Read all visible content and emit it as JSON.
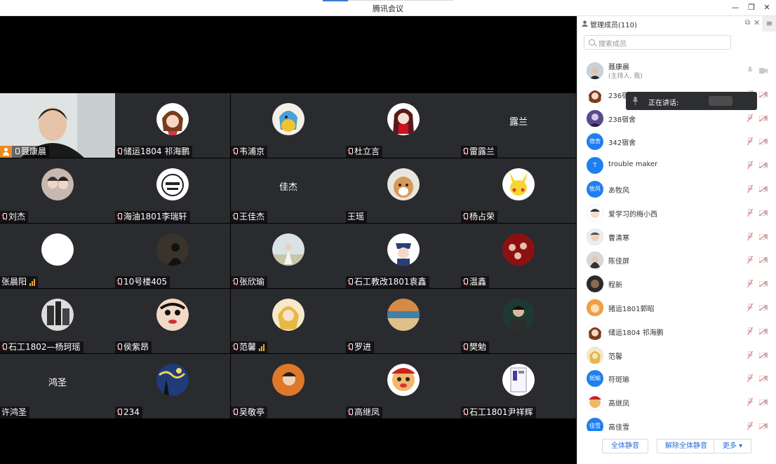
{
  "window": {
    "title": "腾讯会议"
  },
  "tiles": [
    {
      "name": "聂康晨",
      "host": true,
      "mic": "on",
      "type": "video"
    },
    {
      "name": "储运1804 祁海鹏",
      "mic": "muted",
      "type": "avatar",
      "av": "av-anime1"
    },
    {
      "name": "韦浦京",
      "mic": "muted",
      "type": "avatar",
      "av": "av-duck"
    },
    {
      "name": "杜立言",
      "mic": "muted",
      "type": "avatar",
      "av": "av-anime2"
    },
    {
      "name": "雷露兰",
      "mic": "muted",
      "type": "text",
      "big": "露兰"
    },
    {
      "name": "刘杰",
      "mic": "muted",
      "type": "avatar",
      "av": "av-couple"
    },
    {
      "name": "海油1801李瑞轩",
      "mic": "muted",
      "type": "avatar",
      "av": "av-meme"
    },
    {
      "name": "王佳杰",
      "mic": "muted",
      "type": "text",
      "big": "佳杰"
    },
    {
      "name": "王瑶",
      "mic": "none",
      "type": "avatar",
      "av": "av-dog"
    },
    {
      "name": "杨占荣",
      "mic": "muted",
      "type": "avatar",
      "av": "av-pikachu"
    },
    {
      "name": "张晨阳",
      "mic": "none",
      "signal": true,
      "type": "avatar",
      "av": "av-white"
    },
    {
      "name": "10号楼405",
      "mic": "muted",
      "type": "avatar",
      "av": "av-dark"
    },
    {
      "name": "张欣瑜",
      "mic": "muted",
      "type": "avatar",
      "av": "av-girl"
    },
    {
      "name": "石工教改1801袁鑫",
      "mic": "muted",
      "type": "avatar",
      "av": "av-police"
    },
    {
      "name": "温鑫",
      "mic": "muted",
      "type": "avatar",
      "av": "av-red"
    },
    {
      "name": "石工1802—杨珂瑶",
      "mic": "muted",
      "type": "avatar",
      "av": "av-city"
    },
    {
      "name": "侯紫昂",
      "mic": "muted",
      "type": "avatar",
      "av": "av-shin"
    },
    {
      "name": "范馨",
      "mic": "muted",
      "signal": true,
      "type": "avatar",
      "av": "av-yellow"
    },
    {
      "name": "罗进",
      "mic": "muted",
      "type": "avatar",
      "av": "av-sea"
    },
    {
      "name": "樊勉",
      "mic": "muted",
      "type": "avatar",
      "av": "av-boy"
    },
    {
      "name": "许鸿圣",
      "mic": "none",
      "type": "text",
      "big": "鸿圣"
    },
    {
      "name": "234",
      "mic": "muted",
      "type": "avatar",
      "av": "av-starry"
    },
    {
      "name": "吴敬亭",
      "mic": "muted",
      "type": "avatar",
      "av": "av-orange"
    },
    {
      "name": "高继凤",
      "mic": "muted",
      "type": "avatar",
      "av": "av-cartoon"
    },
    {
      "name": "石工1801尹祥辉",
      "mic": "muted",
      "type": "avatar",
      "av": "av-doc"
    }
  ],
  "panel": {
    "title": "管理成员(110)",
    "search_placeholder": "搜索成员",
    "tooltip": "正在讲话:",
    "members": [
      {
        "name": "聂康晨",
        "sub": "(主持人, 我)",
        "av": "photo",
        "mic": "on"
      },
      {
        "name": "236宿",
        "av": "anime",
        "mic": "off"
      },
      {
        "name": "238宿舍",
        "av": "purple",
        "mic": "off"
      },
      {
        "name": "342宿舍",
        "av": "text",
        "avtext": "宿舍",
        "mic": "off"
      },
      {
        "name": "trouble maker",
        "av": "text",
        "avtext": "T",
        "mic": "off"
      },
      {
        "name": "あ牧风",
        "av": "text",
        "avtext": "牧风",
        "mic": "off"
      },
      {
        "name": "爱学习的梅小西",
        "av": "cartoon",
        "mic": "off"
      },
      {
        "name": "曹清寒",
        "av": "boy",
        "mic": "off"
      },
      {
        "name": "陈佳屏",
        "av": "girl",
        "mic": "off"
      },
      {
        "name": "程新",
        "av": "dark",
        "mic": "off"
      },
      {
        "name": "猪运1801郭昭",
        "av": "orange",
        "mic": "off"
      },
      {
        "name": "储运1804 祁海鹏",
        "av": "anime",
        "mic": "off"
      },
      {
        "name": "范馨",
        "av": "yellow",
        "mic": "off"
      },
      {
        "name": "符斑瑜",
        "av": "text",
        "avtext": "斑瑜",
        "mic": "off"
      },
      {
        "name": "高继凤",
        "av": "cartoon2",
        "mic": "off"
      },
      {
        "name": "高佳雪",
        "av": "text",
        "avtext": "佳雪",
        "mic": "off"
      }
    ],
    "buttons": {
      "mute_all": "全体静音",
      "unmute_all": "解除全体静音",
      "more": "更多"
    }
  },
  "colors": {
    "tile_bg": "#2a2b2f",
    "stage_bg": "#000000",
    "accent": "#2b6cd4",
    "muted_red": "#ff5252"
  }
}
